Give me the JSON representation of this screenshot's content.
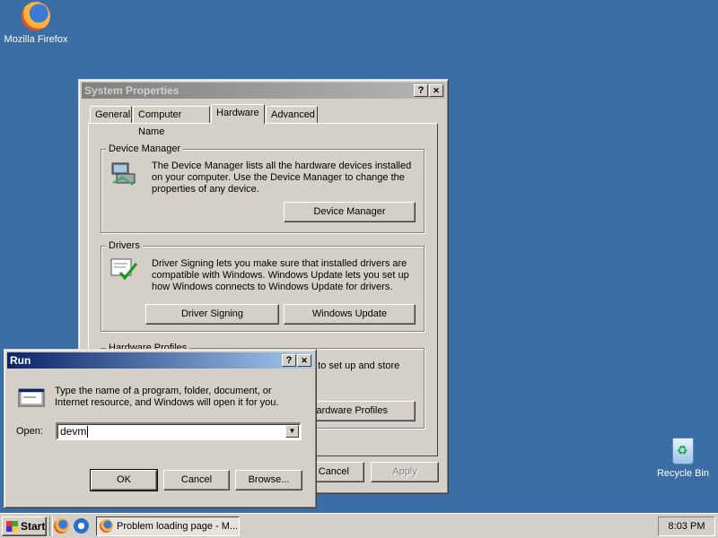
{
  "desktop": {
    "icons": [
      {
        "label": "Mozilla Firefox"
      },
      {
        "label": "Recycle Bin"
      }
    ]
  },
  "system_properties": {
    "title": "System Properties",
    "help_btn": "?",
    "close_btn": "✕",
    "tabs": [
      {
        "label": "General"
      },
      {
        "label": "Computer Name"
      },
      {
        "label": "Hardware",
        "selected": true
      },
      {
        "label": "Advanced"
      }
    ],
    "device_manager": {
      "group_label": "Device Manager",
      "description": "The Device Manager lists all the hardware devices installed on your computer. Use the Device Manager to change the properties of any device.",
      "button": "Device Manager"
    },
    "drivers": {
      "group_label": "Drivers",
      "description": "Driver Signing lets you make sure that installed drivers are compatible with Windows. Windows Update lets you set up how Windows connects to Windows Update for drivers.",
      "driver_signing_button": "Driver Signing",
      "windows_update_button": "Windows Update"
    },
    "hardware_profiles": {
      "group_label": "Hardware Profiles",
      "description_partial": "u to set up and store",
      "button_partial": "Hardware Profiles"
    },
    "buttons": {
      "cancel": "Cancel",
      "apply": "Apply"
    }
  },
  "run_dialog": {
    "title": "Run",
    "help_btn": "?",
    "close_btn": "✕",
    "description": "Type the name of a program, folder, document, or Internet resource, and Windows will open it for you.",
    "open_label": "Open:",
    "open_value": "devm",
    "dropdown_icon": "▼",
    "buttons": {
      "ok": "OK",
      "cancel": "Cancel",
      "browse": "Browse..."
    }
  },
  "taskbar": {
    "start_label": "Start",
    "task_button": "Problem loading page - M...",
    "clock": "8:03 PM"
  }
}
